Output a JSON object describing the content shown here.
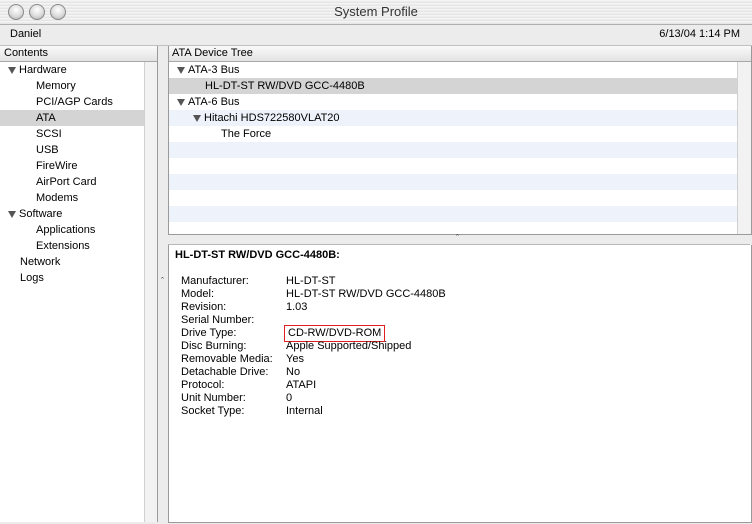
{
  "window": {
    "title": "System Profile"
  },
  "info": {
    "user": "Daniel",
    "datetime": "6/13/04 1:14 PM"
  },
  "contents": {
    "header": "Contents",
    "items": [
      {
        "label": "Hardware",
        "level": 0,
        "expanded": true
      },
      {
        "label": "Memory",
        "level": 1
      },
      {
        "label": "PCI/AGP Cards",
        "level": 1
      },
      {
        "label": "ATA",
        "level": 1,
        "selected": true
      },
      {
        "label": "SCSI",
        "level": 1
      },
      {
        "label": "USB",
        "level": 1
      },
      {
        "label": "FireWire",
        "level": 1
      },
      {
        "label": "AirPort Card",
        "level": 1
      },
      {
        "label": "Modems",
        "level": 1
      },
      {
        "label": "Software",
        "level": 0,
        "expanded": true
      },
      {
        "label": "Applications",
        "level": 1
      },
      {
        "label": "Extensions",
        "level": 1
      },
      {
        "label": "Network",
        "level": 0
      },
      {
        "label": "Logs",
        "level": 0
      }
    ]
  },
  "device_tree": {
    "header": "ATA Device Tree",
    "rows": [
      {
        "label": "ATA-3 Bus",
        "level": 0,
        "expanded": true
      },
      {
        "label": "HL-DT-ST RW/DVD GCC-4480B",
        "level": 1,
        "selected": true
      },
      {
        "label": "ATA-6 Bus",
        "level": 0,
        "expanded": true
      },
      {
        "label": "Hitachi HDS722580VLAT20",
        "level": 1,
        "expanded": true
      },
      {
        "label": "The Force",
        "level": 2
      }
    ]
  },
  "detail": {
    "title": "HL-DT-ST RW/DVD GCC-4480B:",
    "properties": [
      {
        "key": "Manufacturer:",
        "value": "HL-DT-ST"
      },
      {
        "key": "Model:",
        "value": "HL-DT-ST RW/DVD GCC-4480B"
      },
      {
        "key": "Revision:",
        "value": "1.03"
      },
      {
        "key": "Serial Number:",
        "value": ""
      },
      {
        "key": "Drive Type:",
        "value": "CD-RW/DVD-ROM",
        "highlighted": true
      },
      {
        "key": "Disc Burning:",
        "value": "Apple Supported/Shipped"
      },
      {
        "key": "Removable Media:",
        "value": "Yes"
      },
      {
        "key": "Detachable Drive:",
        "value": "No"
      },
      {
        "key": "Protocol:",
        "value": "ATAPI"
      },
      {
        "key": "Unit Number:",
        "value": "0"
      },
      {
        "key": "Socket Type:",
        "value": "Internal"
      }
    ]
  },
  "colors": {
    "selection": "#d4d4d4",
    "stripe": "#eef3fb",
    "highlight_border": "#e02020"
  }
}
